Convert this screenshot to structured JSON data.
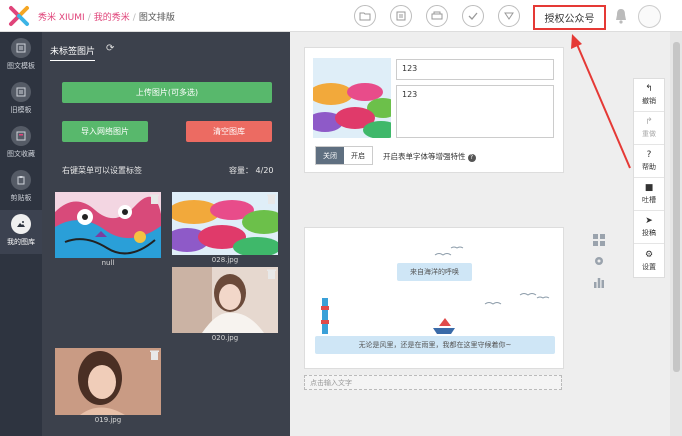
{
  "header": {
    "breadcrumb": [
      "秀米 XIUMI",
      "我的秀米",
      "图文排版"
    ],
    "toolbar_icons": [
      "folder-icon",
      "layers-icon",
      "print-icon",
      "check-icon",
      "download-icon"
    ],
    "authorize_label": "授权公众号"
  },
  "rail": {
    "items": [
      {
        "label": "图文模板",
        "icon": "template-icon",
        "active": false
      },
      {
        "label": "旧模板",
        "icon": "old-template-icon",
        "active": false
      },
      {
        "label": "图文收藏",
        "icon": "favorites-icon",
        "active": false
      },
      {
        "label": "剪贴板",
        "icon": "clipboard-icon",
        "active": false
      },
      {
        "label": "我的图库",
        "icon": "gallery-icon",
        "active": true
      }
    ]
  },
  "library": {
    "tab_label": "未标签图片",
    "upload_label": "上传图片(可多选)",
    "import_label": "导入网络图片",
    "clear_label": "清空图库",
    "hint": "右键菜单可以设置标签",
    "capacity": "容量： 4/20",
    "images": [
      {
        "name": "null"
      },
      {
        "name": "028.jpg"
      },
      {
        "name": "020.jpg"
      },
      {
        "name": "019.jpg"
      }
    ]
  },
  "editor": {
    "title_value": "123",
    "desc_value": "123",
    "toggle_off": "关闭",
    "toggle_on": "开启",
    "toggle_text": "开启表单字体等增强特性",
    "bubble_top": "来自海洋的呼唤",
    "bubble_bottom": "无论是风里，还是在雨里，我都在这里守候着你~",
    "input_placeholder": "点击输入文字"
  },
  "right_toolbar": [
    {
      "label": "撤销",
      "icon": "undo-icon",
      "glyph": "↰",
      "disabled": false
    },
    {
      "label": "重做",
      "icon": "redo-icon",
      "glyph": "↱",
      "disabled": true
    },
    {
      "label": "帮助",
      "icon": "help-icon",
      "glyph": "?",
      "disabled": false
    },
    {
      "label": "吐槽",
      "icon": "comment-icon",
      "glyph": "■",
      "disabled": false
    },
    {
      "label": "投稿",
      "icon": "send-icon",
      "glyph": "➤",
      "disabled": false
    },
    {
      "label": "设置",
      "icon": "settings-icon",
      "glyph": "⚙",
      "disabled": false
    }
  ],
  "colors": {
    "brand": "#e0447a",
    "green_button": "#58b86c",
    "red_button": "#ec6b62",
    "highlight": "#e53935"
  }
}
